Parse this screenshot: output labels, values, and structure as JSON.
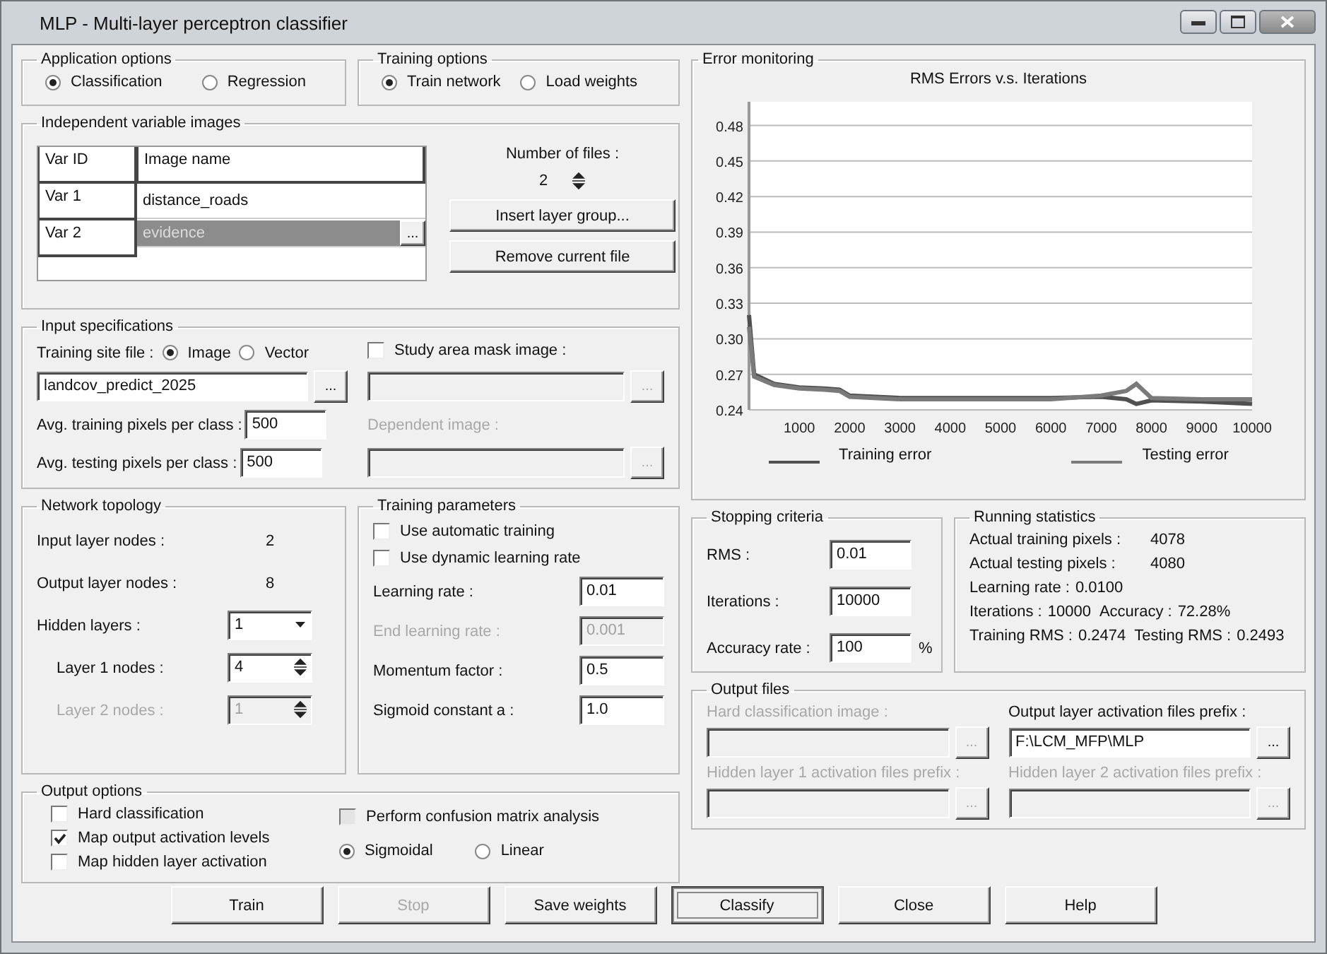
{
  "window": {
    "title": "MLP - Multi-layer perceptron classifier"
  },
  "application_options": {
    "title": "Application options",
    "options": [
      {
        "label": "Classification",
        "selected": true
      },
      {
        "label": "Regression",
        "selected": false
      }
    ]
  },
  "training_options": {
    "title": "Training options",
    "options": [
      {
        "label": "Train network",
        "selected": true
      },
      {
        "label": "Load weights",
        "selected": false
      }
    ]
  },
  "independent_variable_images": {
    "title": "Independent variable images",
    "columns": [
      "Var ID",
      "Image name"
    ],
    "rows": [
      {
        "var_id": "Var 1",
        "image_name": "distance_roads",
        "selected": false
      },
      {
        "var_id": "Var 2",
        "image_name": "evidence",
        "selected": true,
        "button": "..."
      }
    ],
    "number_of_files_label": "Number of files :",
    "number_of_files": "2",
    "buttons": [
      "Insert layer group...",
      "Remove current file"
    ]
  },
  "input_specifications": {
    "title": "Input specifications",
    "training_site_label": "Training site file :",
    "training_site_options": [
      {
        "label": "Image",
        "selected": true
      },
      {
        "label": "Vector",
        "selected": false
      }
    ],
    "training_site_file": {
      "value": "landcov_predict_2025",
      "button": "...",
      "disabled": false
    },
    "fields": [
      {
        "label": "Avg. training pixels per class :",
        "value": "500"
      },
      {
        "label": "Avg. testing pixels per class :",
        "value": "500"
      }
    ],
    "study_area_mask": {
      "label": "Study area mask image :",
      "checked": false
    },
    "mask_file": {
      "button": "...",
      "disabled": true
    },
    "dependent_image": {
      "label": "Dependent image :",
      "button": "...",
      "disabled": true
    }
  },
  "network_topology": {
    "title": "Network topology",
    "rows": [
      {
        "kind": "value",
        "label": "Input layer nodes :",
        "value": "2",
        "disabled": false
      },
      {
        "kind": "value",
        "label": "Output layer nodes :",
        "value": "8",
        "disabled": false
      },
      {
        "kind": "dropdown",
        "label": "Hidden layers :",
        "value": "1",
        "disabled": false
      },
      {
        "kind": "spinner",
        "label": "Layer 1 nodes :",
        "value": "4",
        "disabled": false
      },
      {
        "kind": "spinner",
        "label": "Layer 2 nodes :",
        "value": "1",
        "disabled": true
      }
    ]
  },
  "training_parameters": {
    "title": "Training parameters",
    "checkboxes": [
      {
        "label": "Use automatic training",
        "checked": false
      },
      {
        "label": "Use dynamic learning rate",
        "checked": false
      }
    ],
    "fields": [
      {
        "label": "Learning rate :",
        "value": "0.01",
        "disabled": false
      },
      {
        "label": "End learning rate :",
        "value": "0.001",
        "disabled": true
      },
      {
        "label": "Momentum factor :",
        "value": "0.5",
        "disabled": false
      },
      {
        "label": "Sigmoid constant a :",
        "value": "1.0",
        "disabled": false
      }
    ]
  },
  "output_options": {
    "title": "Output options",
    "checkboxes": [
      {
        "label": "Hard classification",
        "checked": false,
        "disabled": false
      },
      {
        "label": "Map output activation levels",
        "checked": true,
        "disabled": false
      },
      {
        "label": "Map hidden layer activation",
        "checked": false,
        "disabled": false
      }
    ],
    "confusion_matrix": {
      "label": "Perform confusion matrix analysis",
      "checked": false,
      "disabled": true
    },
    "functions": [
      {
        "label": "Sigmoidal",
        "selected": true
      },
      {
        "label": "Linear",
        "selected": false
      }
    ]
  },
  "error_monitoring": {
    "title": "Error monitoring",
    "chart_data": {
      "type": "line",
      "title": "RMS Errors v.s. Iterations",
      "x": [
        0,
        100,
        500,
        1000,
        1500,
        1800,
        2000,
        3000,
        4000,
        5000,
        6000,
        7000,
        7500,
        7700,
        8000,
        9000,
        10000
      ],
      "series": [
        {
          "name": "Training error",
          "color": "#505050",
          "values": [
            0.32,
            0.27,
            0.262,
            0.259,
            0.258,
            0.257,
            0.252,
            0.25,
            0.25,
            0.25,
            0.25,
            0.251,
            0.249,
            0.245,
            0.248,
            0.247,
            0.245
          ]
        },
        {
          "name": "Testing error",
          "color": "#7a7a7a",
          "values": [
            0.31,
            0.268,
            0.261,
            0.258,
            0.257,
            0.256,
            0.251,
            0.249,
            0.249,
            0.249,
            0.249,
            0.252,
            0.256,
            0.262,
            0.25,
            0.249,
            0.249
          ]
        }
      ],
      "xlim": [
        0,
        10000
      ],
      "ylim": [
        0.24,
        0.5
      ],
      "grid": true,
      "legend": true,
      "xticks": [
        1000,
        2000,
        3000,
        4000,
        5000,
        6000,
        7000,
        8000,
        9000,
        10000
      ],
      "yticks": [
        {
          "value": 0.24,
          "label": "0.24"
        },
        {
          "value": 0.27,
          "label": "0.27"
        },
        {
          "value": 0.3,
          "label": "0.30"
        },
        {
          "value": 0.33,
          "label": "0.33"
        },
        {
          "value": 0.36,
          "label": "0.36"
        },
        {
          "value": 0.39,
          "label": "0.39"
        },
        {
          "value": 0.42,
          "label": "0.42"
        },
        {
          "value": 0.45,
          "label": "0.45"
        },
        {
          "value": 0.48,
          "label": "0.48"
        }
      ]
    }
  },
  "stopping_criteria": {
    "title": "Stopping criteria",
    "fields": [
      {
        "label": "RMS :",
        "value": "0.01"
      },
      {
        "label": "Iterations :",
        "value": "10000"
      },
      {
        "label": "Accuracy rate :",
        "value": "100",
        "unit": "%"
      }
    ]
  },
  "running_statistics": {
    "title": "Running statistics",
    "rows": [
      [
        {
          "label": "Actual training pixels :",
          "value": "4078"
        }
      ],
      [
        {
          "label": "Actual testing pixels :",
          "value": "4080"
        }
      ],
      [
        {
          "label": "Learning rate :",
          "value": "0.0100"
        }
      ],
      [
        {
          "label": "Iterations :",
          "value": "10000"
        },
        {
          "label": "Accuracy :",
          "value": "72.28%"
        }
      ],
      [
        {
          "label": "Training RMS :",
          "value": "0.2474"
        },
        {
          "label": "Testing RMS :",
          "value": "0.2493"
        }
      ]
    ]
  },
  "output_files": {
    "title": "Output files",
    "fields": [
      {
        "label": "Hard classification image :",
        "button": "...",
        "disabled": true
      },
      {
        "label": "Output layer activation files prefix :",
        "value": "F:\\LCM_MFP\\MLP",
        "button": "...",
        "disabled": false
      },
      {
        "label": "Hidden layer 1 activation files prefix :",
        "button": "...",
        "disabled": true
      },
      {
        "label": "Hidden layer 2 activation files prefix :",
        "button": "...",
        "disabled": true
      }
    ]
  },
  "buttons": [
    {
      "label": "Train",
      "disabled": false,
      "default": false
    },
    {
      "label": "Stop",
      "disabled": true,
      "default": false
    },
    {
      "label": "Save weights",
      "disabled": false,
      "default": false
    },
    {
      "label": "Classify",
      "disabled": false,
      "default": true
    },
    {
      "label": "Close",
      "disabled": false,
      "default": false
    },
    {
      "label": "Help",
      "disabled": false,
      "default": false
    }
  ]
}
